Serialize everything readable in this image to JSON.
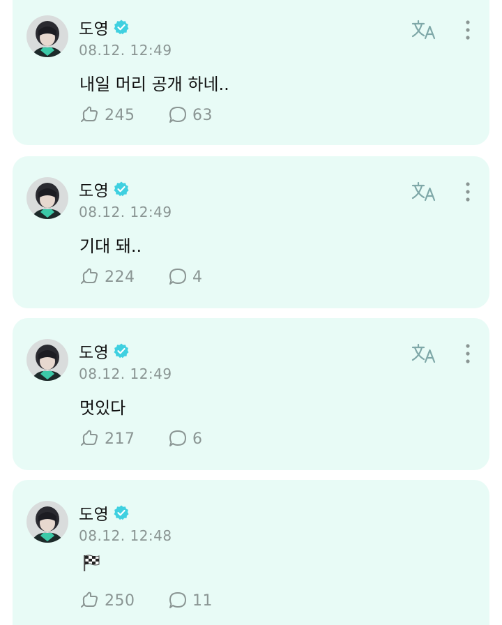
{
  "posts": [
    {
      "author": "도영",
      "timestamp": "08.12. 12:49",
      "text": "내일 머리 공개 하네..",
      "likes": "245",
      "comments": "63"
    },
    {
      "author": "도영",
      "timestamp": "08.12. 12:49",
      "text": "기대 돼..",
      "likes": "224",
      "comments": "4"
    },
    {
      "author": "도영",
      "timestamp": "08.12. 12:49",
      "text": "멋있다",
      "likes": "217",
      "comments": "6"
    },
    {
      "author": "도영",
      "timestamp": "08.12. 12:48",
      "text": "🏁",
      "likes": "250",
      "comments": "11"
    }
  ],
  "icons": {
    "verified": "verified-badge-icon",
    "translate": "translate-icon",
    "more": "more-vertical-icon",
    "like": "like-icon",
    "comment": "comment-icon"
  },
  "colors": {
    "card_background": "#e8fbf6",
    "accent": "#3fd0e0",
    "muted_text": "#8a9593",
    "text": "#111111"
  }
}
